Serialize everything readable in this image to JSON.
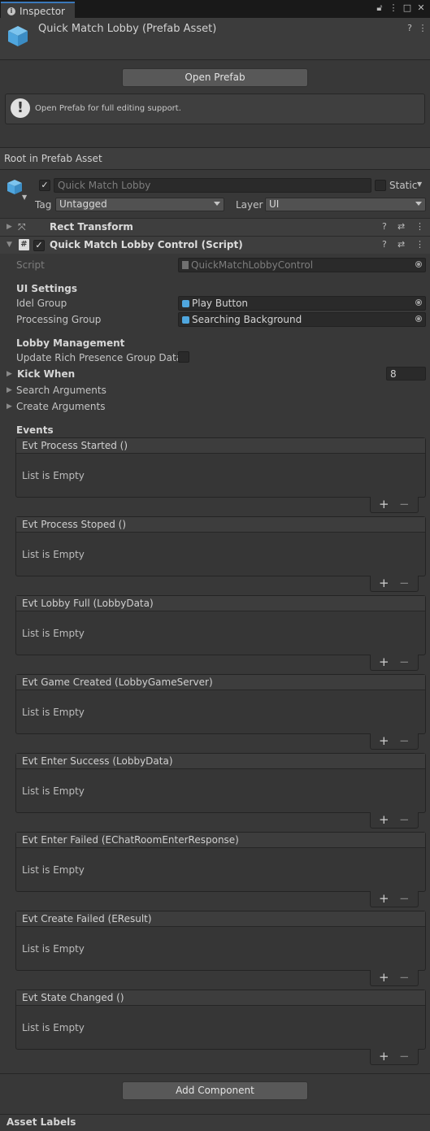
{
  "window": {
    "tab_label": "Inspector",
    "tab_icon": "i"
  },
  "header": {
    "title": "Quick Match Lobby (Prefab Asset)",
    "open_prefab_label": "Open Prefab",
    "help_text": "Open Prefab for full editing support."
  },
  "root_label": "Root in Prefab Asset",
  "gameobject": {
    "name": "Quick Match Lobby",
    "active": true,
    "static_label": "Static",
    "tag_label": "Tag",
    "tag_value": "Untagged",
    "layer_label": "Layer",
    "layer_value": "UI"
  },
  "components": {
    "rect_transform": "Rect Transform",
    "script_component": "Quick Match Lobby Control (Script)"
  },
  "script_fields": {
    "script_label": "Script",
    "script_value": "QuickMatchLobbyControl",
    "ui_settings_header": "UI Settings",
    "idel_group_label": "Idel Group",
    "idel_group_value": "Play Button",
    "processing_group_label": "Processing Group",
    "processing_group_value": "Searching Background",
    "lobby_management_header": "Lobby Management",
    "update_rich_presence_label": "Update Rich Presence Group Data",
    "update_rich_presence_value": false,
    "kick_when_label": "Kick When",
    "kick_when_value": "8",
    "search_arguments_label": "Search Arguments",
    "create_arguments_label": "Create Arguments",
    "events_header": "Events"
  },
  "events": [
    {
      "title": "Evt Process Started ()",
      "empty": "List is Empty"
    },
    {
      "title": "Evt Process Stoped ()",
      "empty": "List is Empty"
    },
    {
      "title": "Evt Lobby Full (LobbyData)",
      "empty": "List is Empty"
    },
    {
      "title": "Evt Game Created (LobbyGameServer)",
      "empty": "List is Empty"
    },
    {
      "title": "Evt Enter Success (LobbyData)",
      "empty": "List is Empty"
    },
    {
      "title": "Evt Enter Failed (EChatRoomEnterResponse)",
      "empty": "List is Empty"
    },
    {
      "title": "Evt Create Failed (EResult)",
      "empty": "List is Empty"
    },
    {
      "title": "Evt State Changed ()",
      "empty": "List is Empty"
    }
  ],
  "list_buttons": {
    "add": "+",
    "remove": "−"
  },
  "add_component_label": "Add Component",
  "asset_labels": "Asset Labels",
  "colors": {
    "accent": "#3a79bb",
    "prefab_cube": "#4fa6de"
  }
}
